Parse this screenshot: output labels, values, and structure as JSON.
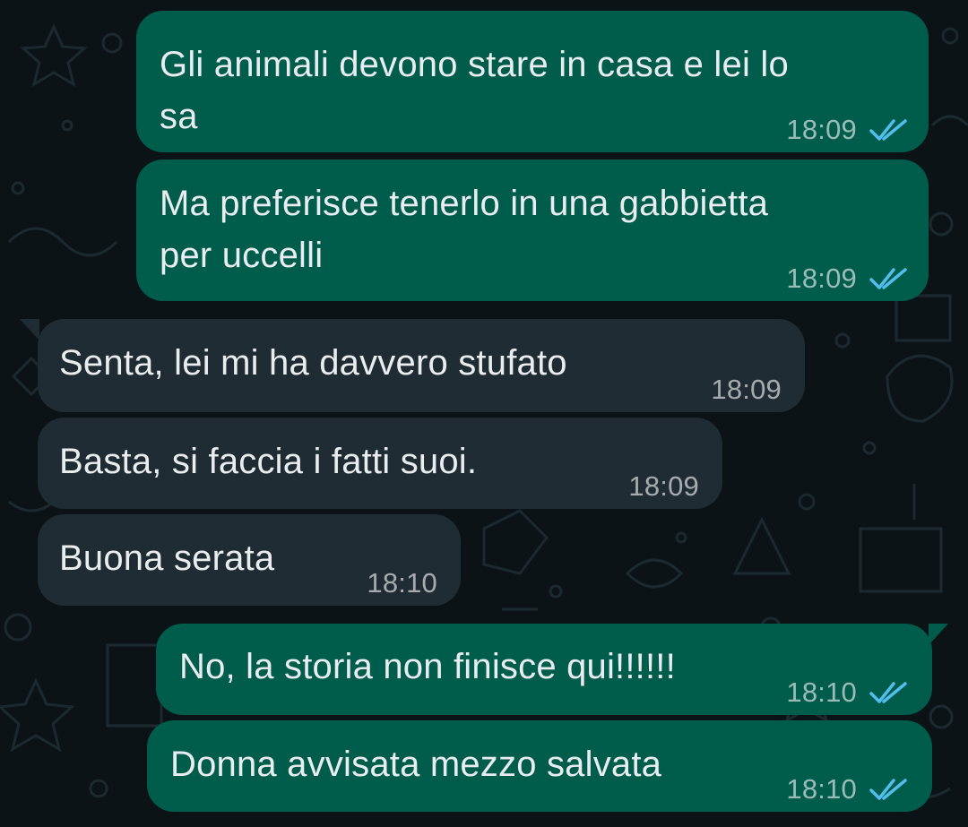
{
  "colors": {
    "background": "#0c1317",
    "outgoing_bubble": "#005c4b",
    "incoming_bubble": "#202c33",
    "text": "#e9edef",
    "read_ticks": "#53bdeb"
  },
  "messages": [
    {
      "direction": "outgoing",
      "text": "Gli animali devono stare in casa e lei lo\nsa",
      "time": "18:09",
      "status": "read",
      "status_icon": "double-check-icon"
    },
    {
      "direction": "outgoing",
      "text": "Ma preferisce tenerlo in una gabbietta\nper uccelli",
      "time": "18:09",
      "status": "read",
      "status_icon": "double-check-icon"
    },
    {
      "direction": "incoming",
      "text": "Senta, lei mi ha davvero stufato",
      "time": "18:09"
    },
    {
      "direction": "incoming",
      "text": "Basta, si faccia i fatti suoi.",
      "time": "18:09"
    },
    {
      "direction": "incoming",
      "text": "Buona serata",
      "time": "18:10"
    },
    {
      "direction": "outgoing",
      "text": "No, la storia non finisce qui!!!!!!",
      "time": "18:10",
      "status": "read",
      "status_icon": "double-check-icon"
    },
    {
      "direction": "outgoing",
      "text": "Donna avvisata mezzo salvata",
      "time": "18:10",
      "status": "read",
      "status_icon": "double-check-icon"
    }
  ]
}
